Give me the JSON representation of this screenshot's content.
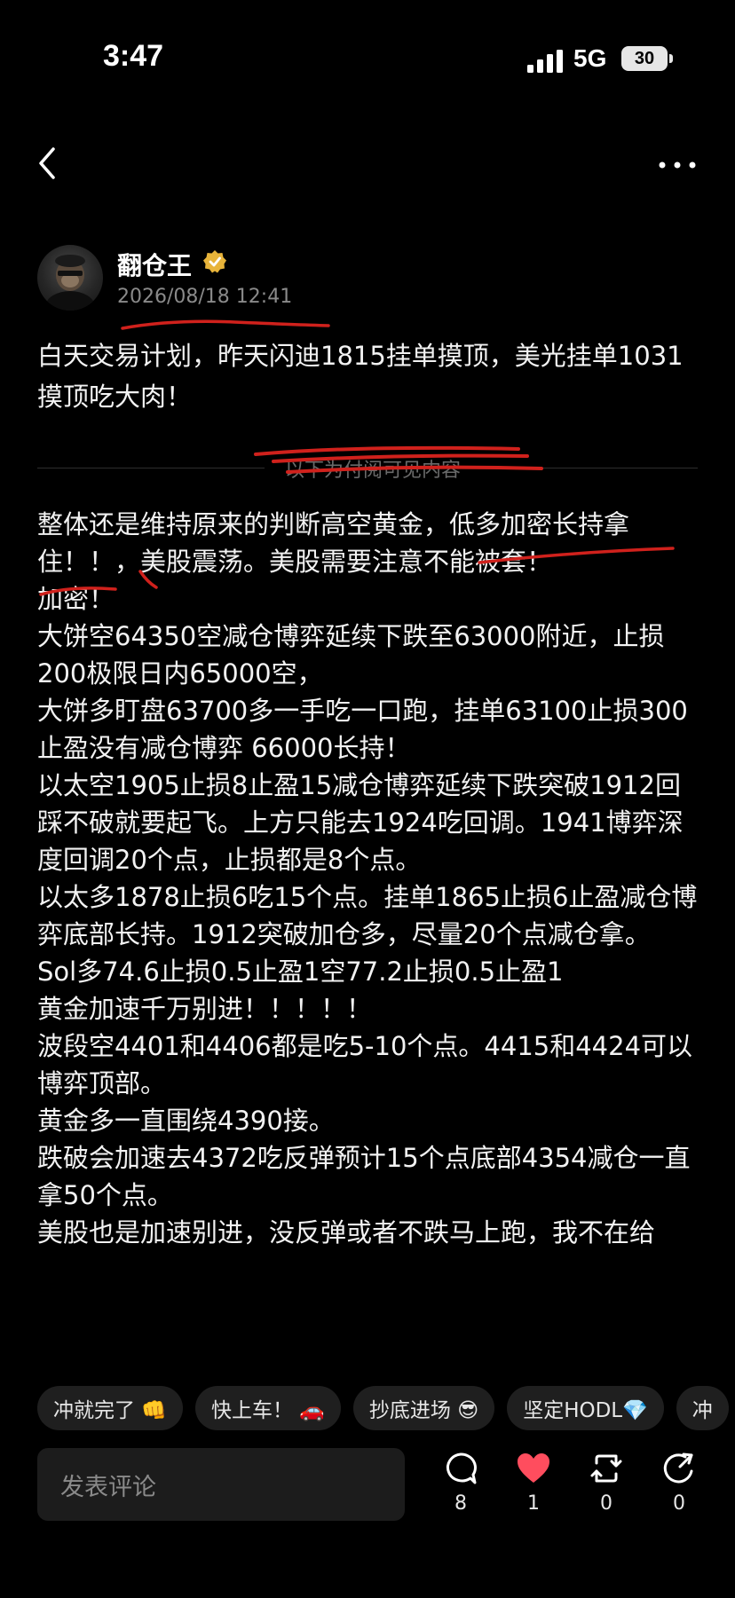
{
  "status_bar": {
    "time": "3:47",
    "network": "5G",
    "battery": "30"
  },
  "author": {
    "name": "翻仓王",
    "date": "2026/08/18 12:41"
  },
  "intro": "白天交易计划，昨天闪迪1815挂单摸顶，美光挂单1031摸顶吃大肉！",
  "divider_text": "以下为付阅可见内容",
  "body_lines": [
    "整体还是维持原来的判断高空黄金，低多加密长持拿住！！，美股震荡。美股需要注意不能被套！",
    "加密！",
    "大饼空64350空减仓博弈延续下跌至63000附近，止损200极限日内65000空，",
    "大饼多盯盘63700多一手吃一口跑，挂单63100止损300止盈没有减仓博弈 66000长持！",
    "以太空1905止损8止盈15减仓博弈延续下跌突破1912回踩不破就要起飞。上方只能去1924吃回调。1941博弈深度回调20个点，止损都是8个点。",
    "以太多1878止损6吃15个点。挂单1865止损6止盈减仓博弈底部长持。1912突破加仓多，尽量20个点减仓拿。",
    "Sol多74.6止损0.5止盈1空77.2止损0.5止盈1",
    "黄金加速千万别进！！！！！",
    "波段空4401和4406都是吃5-10个点。4415和4424可以博弈顶部。",
    "黄金多一直围绕4390接。",
    "跌破会加速去4372吃反弹预计15个点底部4354减仓一直拿50个点。",
    "美股也是加速别进，没反弹或者不跌马上跑，我不在给"
  ],
  "quick_replies": [
    "冲就完了 👊",
    "快上车！ 🚗",
    "抄底进场 😎",
    "坚定HODL💎",
    "冲"
  ],
  "comment_placeholder": "发表评论",
  "actions": {
    "comments": "8",
    "likes": "1",
    "reposts": "0",
    "shares": "0"
  },
  "colors": {
    "background": "#000000",
    "text": "#f2f2f2",
    "muted": "#8a8a8a",
    "like_red": "#ff4d5e",
    "verified_gold": "#e8b43a",
    "annotation_red": "#d0211c"
  }
}
